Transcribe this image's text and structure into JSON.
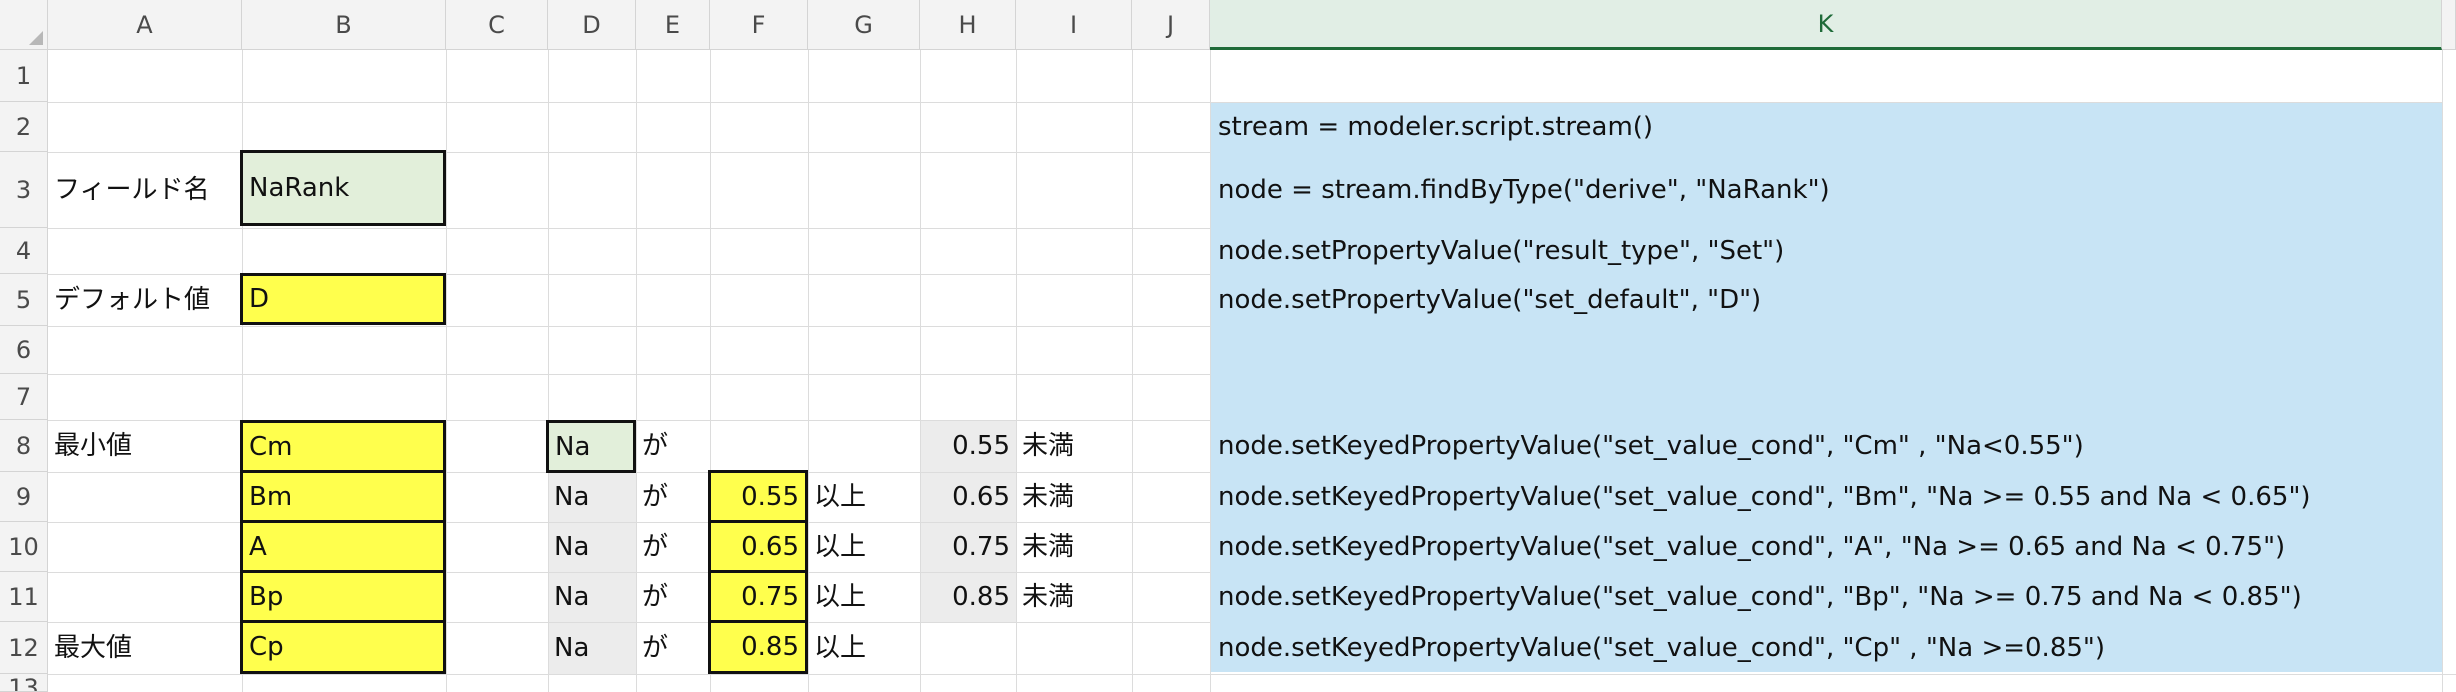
{
  "spreadsheet": {
    "columns": [
      "A",
      "B",
      "C",
      "D",
      "E",
      "F",
      "G",
      "H",
      "I",
      "J",
      "K"
    ],
    "selected_column": "K",
    "rows": [
      "1",
      "2",
      "3",
      "4",
      "5",
      "6",
      "7",
      "8",
      "9",
      "10",
      "11",
      "12",
      "13"
    ],
    "colors": {
      "yellow": "#ffff4d",
      "light_green": "#e2efda",
      "light_gray": "#ececec",
      "light_blue": "#c8e4f5",
      "selected_header": "#1f6b39"
    },
    "cells": {
      "A3": "フィールド名",
      "B3": "NaRank",
      "A5": "デフォルト値",
      "B5": "D",
      "A8": "最小値",
      "B8": "Cm",
      "D8": "Na",
      "E8": "が",
      "H8": "0.55",
      "I8": "未満",
      "B9": "Bm",
      "D9": "Na",
      "E9": "が",
      "F9": "0.55",
      "G9": "以上",
      "H9": "0.65",
      "I9": "未満",
      "B10": "A",
      "D10": "Na",
      "E10": "が",
      "F10": "0.65",
      "G10": "以上",
      "H10": "0.75",
      "I10": "未満",
      "B11": "Bp",
      "D11": "Na",
      "E11": "が",
      "F11": "0.75",
      "G11": "以上",
      "H11": "0.85",
      "I11": "未満",
      "A12": "最大値",
      "B12": "Cp",
      "D12": "Na",
      "E12": "が",
      "F12": "0.85",
      "G12": "以上",
      "K2": "stream = modeler.script.stream()",
      "K3": "node = stream.findByType(\"derive\", \"NaRank\")",
      "K4": "node.setPropertyValue(\"result_type\", \"Set\")",
      "K5": "node.setPropertyValue(\"set_default\", \"D\")",
      "K8": "node.setKeyedPropertyValue(\"set_value_cond\", \"Cm\" ,  \"Na<0.55\")",
      "K9": "node.setKeyedPropertyValue(\"set_value_cond\", \"Bm\",  \"Na >= 0.55 and Na < 0.65\")",
      "K10": "node.setKeyedPropertyValue(\"set_value_cond\", \"A\",  \"Na >= 0.65 and Na < 0.75\")",
      "K11": "node.setKeyedPropertyValue(\"set_value_cond\", \"Bp\",  \"Na >= 0.75 and Na < 0.85\")",
      "K12": "node.setKeyedPropertyValue(\"set_value_cond\", \"Cp\" ,  \"Na >=0.85\")"
    }
  }
}
